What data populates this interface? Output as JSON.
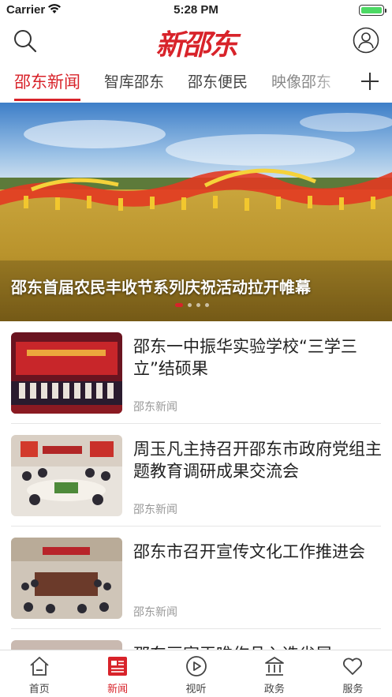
{
  "status": {
    "carrier": "Carrier",
    "time": "5:28 PM"
  },
  "header": {
    "logo": "新邵东"
  },
  "tabs": [
    {
      "label": "邵东新闻"
    },
    {
      "label": "智库邵东"
    },
    {
      "label": "邵东便民"
    },
    {
      "label": "映像邵东"
    }
  ],
  "banner": {
    "caption": "邵东首届农民丰收节系列庆祝活动拉开帷幕",
    "slide_index": 1,
    "slide_count": 4
  },
  "news": [
    {
      "title": "邵东一中振华实验学校“三学三立”结硕果",
      "source": "邵东新闻"
    },
    {
      "title": "周玉凡主持召开邵东市政府党组主题教育调研成果交流会",
      "source": "邵东新闻"
    },
    {
      "title": "邵东市召开宣传文化工作推进会",
      "source": "邵东新闻"
    },
    {
      "title": "邵东画家王唯作品入选省展",
      "source": ""
    }
  ],
  "tabbar": [
    {
      "label": "首页",
      "icon": "home-icon"
    },
    {
      "label": "新闻",
      "icon": "news-icon"
    },
    {
      "label": "视听",
      "icon": "play-icon"
    },
    {
      "label": "政务",
      "icon": "government-icon"
    },
    {
      "label": "服务",
      "icon": "heart-icon"
    }
  ],
  "colors": {
    "accent": "#d8232a"
  }
}
